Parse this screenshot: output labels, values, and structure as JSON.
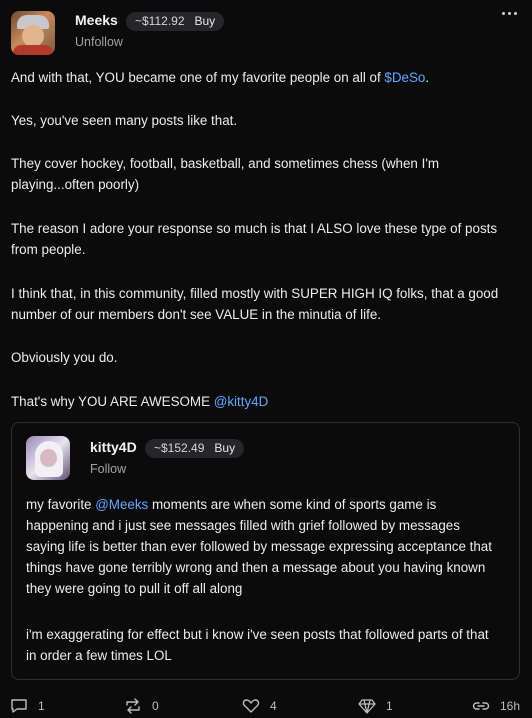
{
  "post": {
    "author": {
      "name": "Meeks",
      "price": "~$112.92",
      "buy_label": "Buy",
      "follow_label": "Unfollow"
    },
    "paragraphs": [
      {
        "segments": [
          {
            "text": "And with that, YOU became one of my favorite people on all of "
          },
          {
            "text": "$DeSo",
            "link": true
          },
          {
            "text": "."
          }
        ]
      },
      {
        "segments": [
          {
            "text": "Yes, you've seen many posts like that."
          }
        ]
      },
      {
        "segments": [
          {
            "text": "They cover hockey, football, basketball, and sometimes chess (when I'm playing...often poorly)"
          }
        ]
      },
      {
        "segments": [
          {
            "text": "The reason I adore your response so much is that I ALSO love these type of posts from people."
          }
        ]
      },
      {
        "segments": [
          {
            "text": "I think that, in this community, filled mostly with SUPER HIGH IQ folks, that a good number of our members don't see VALUE in the minutia of life."
          }
        ]
      },
      {
        "segments": [
          {
            "text": "Obviously you do."
          }
        ]
      },
      {
        "segments": [
          {
            "text": "That's why YOU ARE AWESOME "
          },
          {
            "text": "@kitty4D",
            "link": true
          }
        ]
      }
    ]
  },
  "quoted": {
    "author": {
      "name": "kitty4D",
      "price": "~$152.49",
      "buy_label": "Buy",
      "follow_label": "Follow"
    },
    "paragraphs": [
      {
        "segments": [
          {
            "text": "my favorite "
          },
          {
            "text": "@Meeks",
            "link": true
          },
          {
            "text": " moments are when some kind of sports game is happening and i just see messages filled with grief followed by messages saying life is better than ever followed by message expressing acceptance that things have gone terribly wrong and then a message about you having known they were going to pull it off all along"
          }
        ]
      },
      {
        "segments": [
          {
            "text": "i'm exaggerating for effect but i know i've seen posts that followed parts of that in order a few times LOL"
          }
        ]
      }
    ]
  },
  "footer": {
    "comments": "1",
    "reposts": "0",
    "likes": "4",
    "diamonds": "1",
    "time": "16h"
  },
  "colors": {
    "link": "#63a7ff",
    "background": "#0b0b0c"
  }
}
